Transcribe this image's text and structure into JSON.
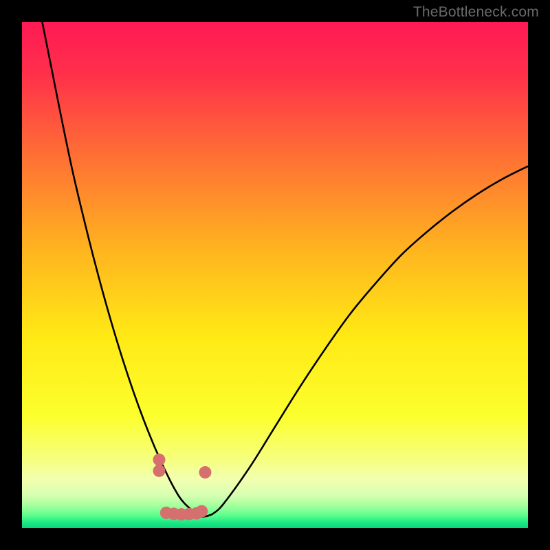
{
  "watermark": "TheBottleneck.com",
  "chart_data": {
    "type": "line",
    "title": "",
    "xlabel": "",
    "ylabel": "",
    "xlim": [
      0,
      100
    ],
    "ylim": [
      0,
      100
    ],
    "grid": false,
    "series": [
      {
        "name": "bottleneck-curve",
        "x": [
          4,
          6,
          8,
          10,
          12,
          14,
          16,
          18,
          20,
          22,
          24,
          26,
          27.1,
          28,
          30,
          32,
          35,
          36.2,
          37,
          38,
          40,
          45,
          50,
          55,
          60,
          65,
          70,
          75,
          80,
          85,
          90,
          95,
          100
        ],
        "y": [
          100,
          90,
          80,
          70.5,
          62,
          54,
          46.5,
          39.5,
          33,
          27,
          21.5,
          16.5,
          14,
          12,
          8,
          5,
          2.5,
          2.3,
          2.5,
          3,
          5,
          12,
          20,
          28,
          35.5,
          42.5,
          48.5,
          54,
          58.5,
          62.5,
          66,
          69,
          71.5
        ]
      },
      {
        "name": "highlight-dots",
        "x": [
          27.1,
          27.1,
          28.5,
          30,
          31.5,
          33,
          34.5,
          35.5,
          36.2
        ],
        "y": [
          13.5,
          11.3,
          3.0,
          2.8,
          2.7,
          2.75,
          2.9,
          3.3,
          11.0
        ]
      }
    ],
    "colors": {
      "curve": "#000000",
      "dots": "#d6706f",
      "gradient_stops": [
        {
          "pos": 0.0,
          "color": "#ff1a55"
        },
        {
          "pos": 0.1,
          "color": "#ff2f4a"
        },
        {
          "pos": 0.25,
          "color": "#ff6a36"
        },
        {
          "pos": 0.45,
          "color": "#ffb41f"
        },
        {
          "pos": 0.62,
          "color": "#ffe915"
        },
        {
          "pos": 0.78,
          "color": "#fcff2e"
        },
        {
          "pos": 0.86,
          "color": "#f6ff7a"
        },
        {
          "pos": 0.905,
          "color": "#f2ffb1"
        },
        {
          "pos": 0.935,
          "color": "#d7ffb1"
        },
        {
          "pos": 0.955,
          "color": "#a7ff9e"
        },
        {
          "pos": 0.975,
          "color": "#5dff8e"
        },
        {
          "pos": 0.99,
          "color": "#18e884"
        },
        {
          "pos": 1.0,
          "color": "#0fd47a"
        }
      ]
    }
  }
}
